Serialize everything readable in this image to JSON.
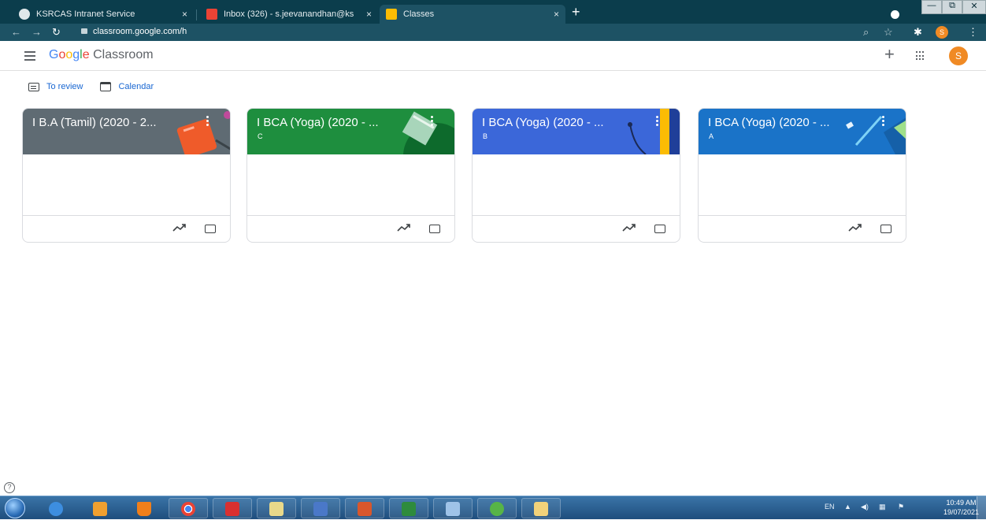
{
  "browser": {
    "tabs": [
      {
        "title": "KSRCAS Intranet Service",
        "close": "×",
        "active": false
      },
      {
        "title": "Inbox (326) - s.jeevanandhan@ks",
        "close": "×",
        "active": false
      },
      {
        "title": "Classes",
        "close": "×",
        "active": true
      }
    ],
    "new_tab": "+",
    "url": "classroom.google.com/h",
    "window_controls": {
      "minimize": "—",
      "maximize": "⧉",
      "close": "✕"
    },
    "profile_initial": "S"
  },
  "app": {
    "brand_google": [
      "G",
      "o",
      "o",
      "g",
      "l",
      "e"
    ],
    "brand_product": "Classroom",
    "create_label": "+",
    "user_initial": "S"
  },
  "subnav": {
    "to_review": "To review",
    "calendar": "Calendar"
  },
  "classes": [
    {
      "title": "I B.A (Tamil) (2020 - 2...",
      "section": "",
      "color": "#5f6b73"
    },
    {
      "title": "I BCA (Yoga) (2020 - ...",
      "section": "C",
      "color": "#1e8e3e"
    },
    {
      "title": "I BCA (Yoga) (2020 - ...",
      "section": "B",
      "color": "#3b67d9"
    },
    {
      "title": "I BCA (Yoga) (2020 - ...",
      "section": "A",
      "color": "#1a73c8"
    }
  ],
  "help_label": "?",
  "taskbar": {
    "language": "EN",
    "time": "10:49 AM",
    "date": "19/07/2021"
  }
}
